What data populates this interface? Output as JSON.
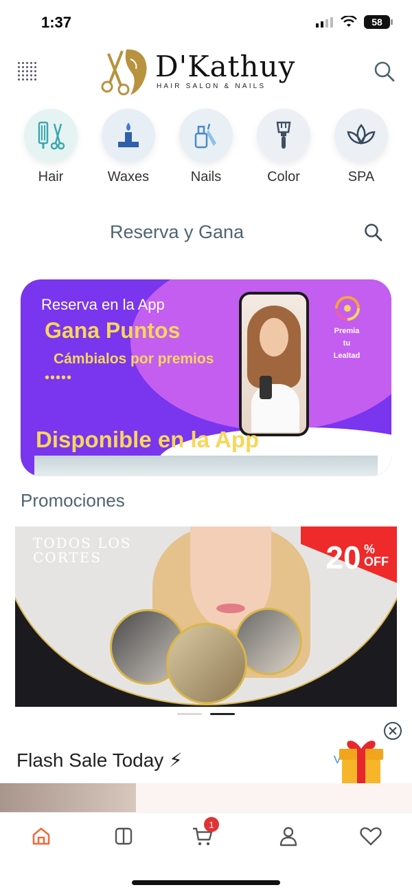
{
  "status_bar": {
    "time": "1:37",
    "battery": "58"
  },
  "header": {
    "brand_name": "D'Kathuy",
    "brand_tagline": "HAIR SALON & NAILS"
  },
  "categories": [
    {
      "label": "Hair",
      "icon": "hair-tools-icon"
    },
    {
      "label": "Waxes",
      "icon": "candle-icon"
    },
    {
      "label": "Nails",
      "icon": "nail-polish-icon"
    },
    {
      "label": "Color",
      "icon": "dye-brush-icon"
    },
    {
      "label": "SPA",
      "icon": "lotus-icon"
    }
  ],
  "reserva": {
    "title": "Reserva y Gana"
  },
  "banner": {
    "line1": "Reserva en la App",
    "line2": "Gana Puntos",
    "line3": "Cámbialos por premios",
    "dots": "•••••",
    "line4": "Disponible en la App",
    "premia": [
      "Premia",
      "tu",
      "Lealtad"
    ]
  },
  "promociones": {
    "title": "Promociones",
    "card_title": "TODOS LOS CORTES",
    "discount_number": "20",
    "discount_pct": "%",
    "discount_off": "OFF"
  },
  "carousel": {
    "pages": 2,
    "active_index": 1
  },
  "flash_sale": {
    "title": "Flash Sale Today ⚡",
    "view_all_fragment": "V"
  },
  "bottom_nav": {
    "items": [
      "home-icon",
      "catalog-icon",
      "cart-icon",
      "profile-icon",
      "favorites-icon"
    ],
    "cart_count": "1",
    "active": "home-icon"
  },
  "colors": {
    "accent": "#f06a3a",
    "banner_purple": "#7a35ee",
    "banner_yellow": "#f6d75a",
    "badge_red": "#e03434",
    "title_grey": "#4f6470"
  }
}
